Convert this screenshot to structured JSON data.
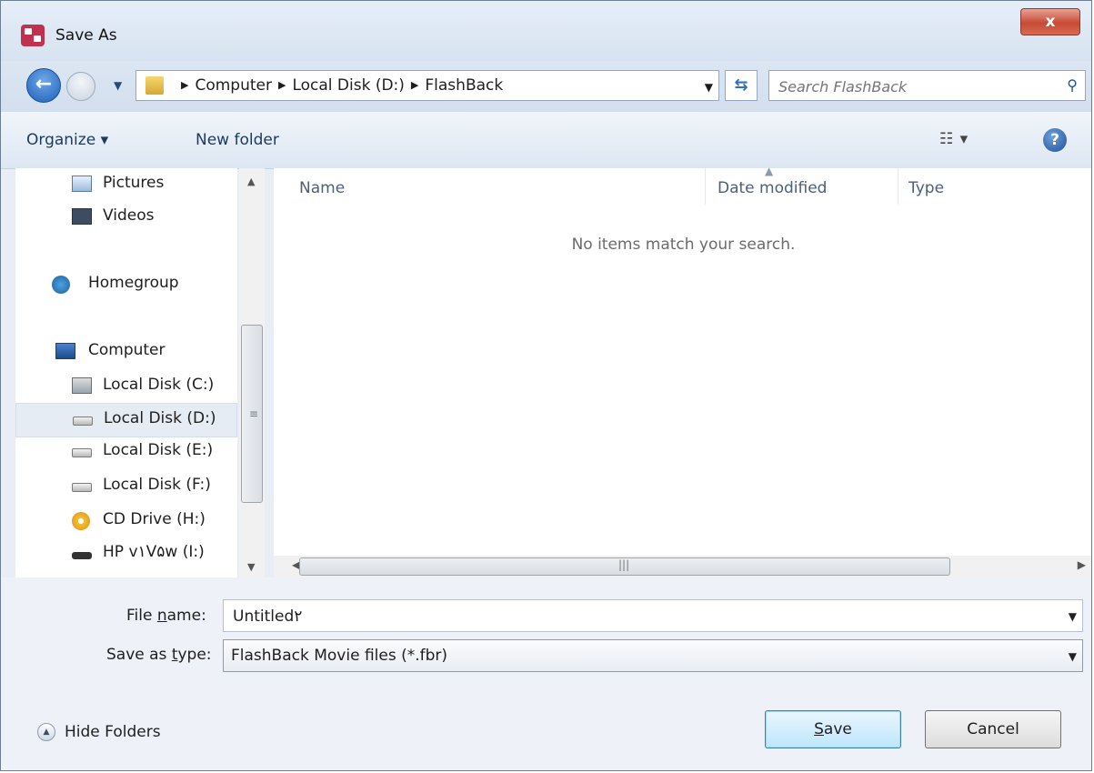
{
  "window": {
    "title": "Save As",
    "close_glyph": "x"
  },
  "navigation": {
    "breadcrumbs": [
      "Computer",
      "Local Disk (D:)",
      "FlashBack"
    ],
    "search_placeholder": "Search FlashBack"
  },
  "toolbar": {
    "organize_label": "Organize ▾",
    "new_folder_label": "New folder",
    "views_glyph": "☷ ▾",
    "help_glyph": "?"
  },
  "nav_pane": {
    "items": [
      {
        "label": "Pictures",
        "icon": "pictures-icon"
      },
      {
        "label": "Videos",
        "icon": "videos-icon"
      },
      {
        "label": "Homegroup",
        "icon": "homegroup-icon"
      },
      {
        "label": "Computer",
        "icon": "computer-icon"
      },
      {
        "label": "Local Disk (C:)",
        "icon": "system-disk-icon"
      },
      {
        "label": "Local Disk (D:)",
        "icon": "disk-icon",
        "selected": true
      },
      {
        "label": "Local Disk (E:)",
        "icon": "disk-icon"
      },
      {
        "label": "Local Disk (F:)",
        "icon": "disk-icon"
      },
      {
        "label": "CD Drive (H:)",
        "icon": "cd-drive-icon"
      },
      {
        "label": "HP v١V۵w (I:)",
        "icon": "removable-drive-icon"
      }
    ]
  },
  "file_list": {
    "columns": [
      "Name",
      "Date modified",
      "Type"
    ],
    "empty_message": "No items match your search."
  },
  "form": {
    "file_name_label_pre": "File ",
    "file_name_label_u": "n",
    "file_name_label_post": "ame:",
    "file_name_value": "Untitled۲",
    "save_type_label_pre": "Save as ",
    "save_type_label_u": "t",
    "save_type_label_post": "ype:",
    "save_type_value": "FlashBack Movie files (*.fbr)"
  },
  "footer": {
    "hide_folders_label": "Hide Folders",
    "save_label_u": "S",
    "save_label_rest": "ave",
    "cancel_label": "Cancel"
  },
  "colors": {
    "accent": "#3c7fb1",
    "window_bg": "#e9eef6",
    "close_red": "#c74a35"
  }
}
